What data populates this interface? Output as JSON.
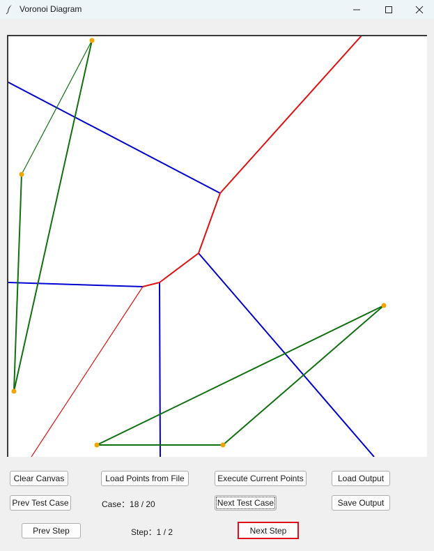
{
  "window": {
    "title": "Voronoi Diagram",
    "icons": [
      "feather-icon",
      "minimize-icon",
      "maximize-icon",
      "close-icon"
    ]
  },
  "controls": {
    "clear_canvas": "Clear Canvas",
    "load_points": "Load Points from File",
    "execute_points": "Execute Current Points",
    "load_output": "Load Output",
    "prev_test_case": "Prev Test Case",
    "case_label": "Case：18 / 20",
    "next_test_case": "Next Test Case",
    "save_output": "Save Output",
    "prev_step": "Prev Step",
    "step_label": "Step：1 / 2",
    "next_step": "Next Step"
  },
  "colors": {
    "point": "#f0a500",
    "voronoi_blue": "#0000d0",
    "voronoi_red": "#e01010",
    "hull_green": "#107010",
    "next_step_highlight": "#e0101a"
  }
}
